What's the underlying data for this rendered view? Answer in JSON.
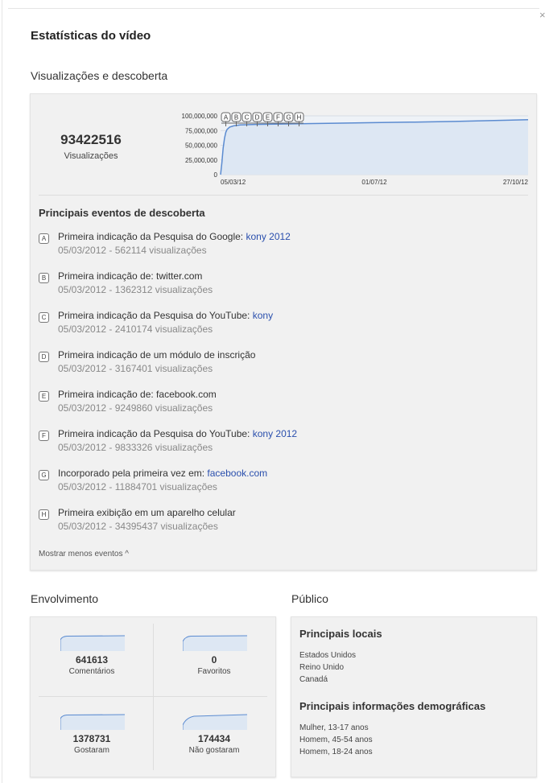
{
  "window": {
    "close_glyph": "×"
  },
  "title": "Estatísticas do vídeo",
  "views_section": {
    "title": "Visualizações e descoberta",
    "total_views": "93422516",
    "total_label": "Visualizações"
  },
  "chart_data": {
    "type": "area",
    "title": "",
    "xlabel": "",
    "ylabel": "",
    "ylim": [
      0,
      100000000
    ],
    "y_ticks": [
      "100,000,000",
      "75,000,000",
      "50,000,000",
      "25,000,000",
      "0"
    ],
    "x_ticks": [
      "05/03/12",
      "01/07/12",
      "27/10/12"
    ],
    "x_domain": [
      "2012-03-05",
      "2012-10-27"
    ],
    "series": [
      {
        "x": [
          "2012-03-05",
          "2012-03-06",
          "2012-03-07",
          "2012-03-08",
          "2012-03-09",
          "2012-03-10",
          "2012-03-12",
          "2012-03-15",
          "2012-03-20",
          "2012-04-01",
          "2012-05-01",
          "2012-06-01",
          "2012-07-01",
          "2012-08-01",
          "2012-09-01",
          "2012-10-01",
          "2012-10-27"
        ],
        "values": [
          0,
          20000000,
          45000000,
          62000000,
          72000000,
          77000000,
          81000000,
          83000000,
          84500000,
          85500000,
          86500000,
          87500000,
          88500000,
          89500000,
          90500000,
          92000000,
          93422516
        ]
      }
    ],
    "event_markers": [
      "A",
      "B",
      "C",
      "D",
      "E",
      "F",
      "G",
      "H"
    ]
  },
  "events": {
    "title": "Principais eventos de descoberta",
    "toggle_label": "Mostrar menos eventos ^",
    "items": [
      {
        "badge": "A",
        "text": "Primeira indicação da Pesquisa do Google: ",
        "link": "kony 2012",
        "detail": "05/03/2012 - 562114 visualizações"
      },
      {
        "badge": "B",
        "text": "Primeira indicação de: twitter.com",
        "link": "",
        "detail": "05/03/2012 - 1362312 visualizações"
      },
      {
        "badge": "C",
        "text": "Primeira indicação da Pesquisa do YouTube: ",
        "link": "kony",
        "detail": "05/03/2012 - 2410174 visualizações"
      },
      {
        "badge": "D",
        "text": "Primeira indicação de um módulo de inscrição",
        "link": "",
        "detail": "05/03/2012 - 3167401 visualizações"
      },
      {
        "badge": "E",
        "text": "Primeira indicação de: facebook.com",
        "link": "",
        "detail": "05/03/2012 - 9249860 visualizações"
      },
      {
        "badge": "F",
        "text": "Primeira indicação da Pesquisa do YouTube: ",
        "link": "kony 2012",
        "detail": "05/03/2012 - 9833326 visualizações"
      },
      {
        "badge": "G",
        "text": "Incorporado pela primeira vez em: ",
        "link": "facebook.com",
        "detail": "05/03/2012 - 11884701 visualizações"
      },
      {
        "badge": "H",
        "text": "Primeira exibição em um aparelho celular",
        "link": "",
        "detail": "05/03/2012 - 34395437 visualizações"
      }
    ]
  },
  "engagement": {
    "title": "Envolvimento",
    "metrics": [
      {
        "value": "641613",
        "label": "Comentários"
      },
      {
        "value": "0",
        "label": "Favoritos"
      },
      {
        "value": "1378731",
        "label": "Gostaram"
      },
      {
        "value": "174434",
        "label": "Não gostaram"
      }
    ]
  },
  "audience": {
    "title": "Público",
    "locations_title": "Principais locais",
    "locations": [
      "Estados Unidos",
      "Reino Unido",
      "Canadá"
    ],
    "demographics_title": "Principais informações demográficas",
    "demographics": [
      "Mulher, 13-17 anos",
      "Homem, 45-54 anos",
      "Homem, 18-24 anos"
    ]
  },
  "colors": {
    "line": "#5b8bd0",
    "area": "#dde7f3",
    "link": "#2a4fad"
  }
}
